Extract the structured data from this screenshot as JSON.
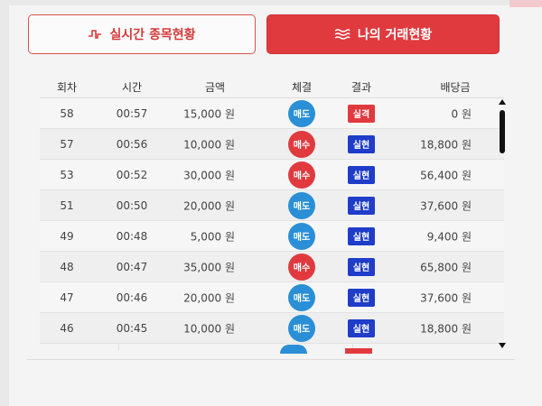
{
  "tabs": {
    "live_label": "실시간 종목현황",
    "mine_label": "나의 거래현황"
  },
  "table": {
    "headers": [
      "회차",
      "시간",
      "금액",
      "체결",
      "결과",
      "배당금"
    ],
    "rows": [
      {
        "round": "58",
        "time": "00:57",
        "amount": "15,000 원",
        "trade": "매도",
        "result": "실격",
        "payout": "0 원"
      },
      {
        "round": "57",
        "time": "00:56",
        "amount": "10,000 원",
        "trade": "매수",
        "result": "실현",
        "payout": "18,800 원"
      },
      {
        "round": "53",
        "time": "00:52",
        "amount": "30,000 원",
        "trade": "매수",
        "result": "실현",
        "payout": "56,400 원"
      },
      {
        "round": "51",
        "time": "00:50",
        "amount": "20,000 원",
        "trade": "매도",
        "result": "실현",
        "payout": "37,600 원"
      },
      {
        "round": "49",
        "time": "00:48",
        "amount": "5,000 원",
        "trade": "매도",
        "result": "실현",
        "payout": "9,400 원"
      },
      {
        "round": "48",
        "time": "00:47",
        "amount": "35,000 원",
        "trade": "매수",
        "result": "실현",
        "payout": "65,800 원"
      },
      {
        "round": "47",
        "time": "00:46",
        "amount": "20,000 원",
        "trade": "매도",
        "result": "실현",
        "payout": "37,600 원"
      },
      {
        "round": "46",
        "time": "00:45",
        "amount": "10,000 원",
        "trade": "매도",
        "result": "실현",
        "payout": "18,800 원"
      }
    ]
  },
  "colors": {
    "accent_red": "#e03a3f",
    "sell_blue": "#2a8fd6",
    "win_blue": "#1f3dc9"
  },
  "icons": {
    "live_tab_icon": "pulse-icon",
    "mine_tab_icon": "waves-icon"
  }
}
